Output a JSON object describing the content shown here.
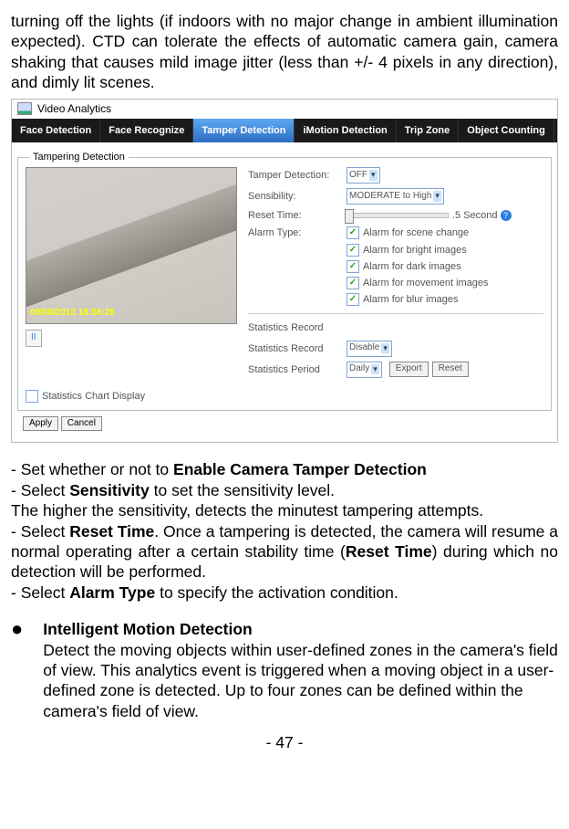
{
  "intro": "turning off the lights (if indoors with no major change in ambient illumination expected). CTD can tolerate the effects of automatic camera gain, camera shaking that causes mild image jitter (less than +/- 4 pixels in any direction), and dimly lit scenes.",
  "app": {
    "title": "Video Analytics",
    "tabs": [
      "Face Detection",
      "Face Recognize",
      "Tamper Detection",
      "iMotion Detection",
      "Trip Zone",
      "Object Counting"
    ],
    "legend": "Tampering Detection",
    "timestamp": "09/08/2013  18:38:28",
    "pause": "II",
    "form": {
      "tamper_label": "Tamper Detection:",
      "tamper_value": "OFF",
      "sens_label": "Sensibility:",
      "sens_value": "MODERATE to High",
      "reset_label": "Reset Time:",
      "reset_value": ".5 Second",
      "alarm_label": "Alarm Type:",
      "alarms": [
        "Alarm for scene change",
        "Alarm for bright images",
        "Alarm for dark images",
        "Alarm for movement images",
        "Alarm for blur images"
      ],
      "stats_title": "Statistics Record",
      "stats_record_label": "Statistics Record",
      "stats_record_value": "Disable",
      "stats_period_label": "Statistics Period",
      "stats_period_value": "Daily",
      "export": "Export",
      "reset": "Reset",
      "chart_display": "Statistics Chart Display",
      "apply": "Apply",
      "cancel": "Cancel"
    }
  },
  "body": {
    "l1a": "- Set whether or not to ",
    "l1b": "Enable Camera Tamper Detection",
    "l2a": "- Select ",
    "l2b": "Sensitivity",
    "l2c": " to set the sensitivity level.",
    "l3": "The higher the sensitivity, detects the minutest tampering attempts.",
    "l4a": "- Select ",
    "l4b": "Reset Time",
    "l4c": ". Once a tampering is detected, the camera will resume a normal operating after a certain stability time (",
    "l4d": "Reset Time",
    "l4e": ") during which no detection will be performed.",
    "l5a": "- Select ",
    "l5b": "Alarm Type",
    "l5c": " to specify the activation condition."
  },
  "imd": {
    "title": "Intelligent Motion Detection",
    "desc": "Detect the moving objects within user-defined zones in the camera's field of view. This analytics event is triggered when a moving object in a user-defined zone is detected. Up to four zones can be defined within the camera's field of view."
  },
  "page": "- 47 -"
}
